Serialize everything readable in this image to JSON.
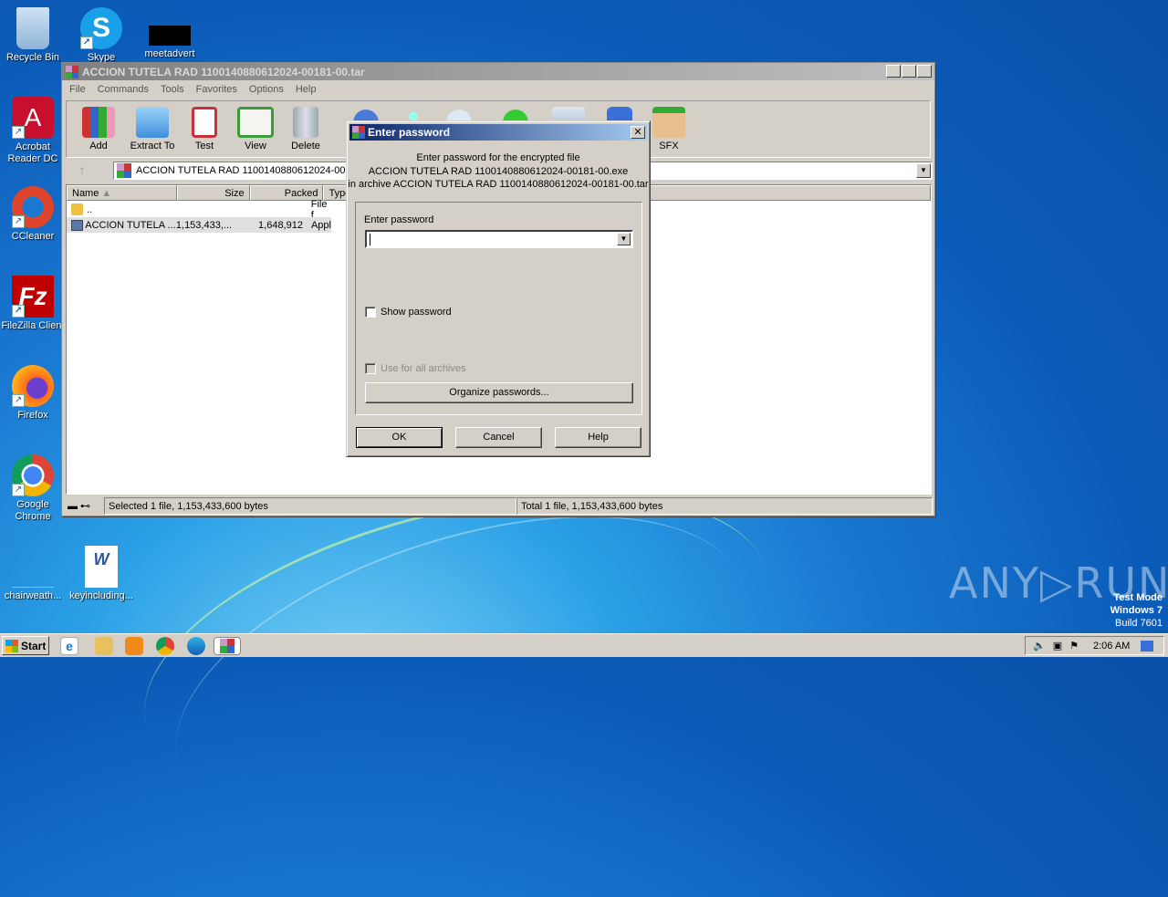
{
  "desktop": {
    "icons": [
      {
        "label": "Recycle Bin",
        "icon": "recycle-bin-icon"
      },
      {
        "label": "Skype",
        "icon": "skype-icon"
      },
      {
        "label": "meetadvert",
        "icon": "file-icon"
      },
      {
        "label": "Acrobat Reader DC",
        "icon": "acrobat-icon"
      },
      {
        "label": "CCleaner",
        "icon": "ccleaner-icon"
      },
      {
        "label": "FileZilla Client",
        "icon": "filezilla-icon"
      },
      {
        "label": "Firefox",
        "icon": "firefox-icon"
      },
      {
        "label": "Google Chrome",
        "icon": "chrome-icon"
      },
      {
        "label": "chairweath...",
        "icon": "blank-file-icon"
      },
      {
        "label": "keyincluding...",
        "icon": "word-doc-icon"
      }
    ],
    "watermark": {
      "brand": "ANY▷RUN",
      "line1": "Test Mode",
      "line2": "Windows 7",
      "line3": "Build 7601"
    }
  },
  "window": {
    "title": "ACCION TUTELA RAD 1100140880612024-00181-00.tar",
    "menu": [
      "File",
      "Commands",
      "Tools",
      "Favorites",
      "Options",
      "Help"
    ],
    "toolbar": [
      {
        "label": "Add",
        "icon": "add-icon"
      },
      {
        "label": "Extract To",
        "icon": "extract-icon"
      },
      {
        "label": "Test",
        "icon": "test-icon"
      },
      {
        "label": "View",
        "icon": "view-icon"
      },
      {
        "label": "Delete",
        "icon": "delete-icon"
      },
      {
        "label": "SFX",
        "icon": "sfx-icon"
      }
    ],
    "address": "ACCION TUTELA RAD 1100140880612024-00181-00.tar",
    "columns": [
      "Name",
      "Size",
      "Packed",
      "Type"
    ],
    "rows": [
      {
        "name": "..",
        "size": "",
        "packed": "",
        "type": "File f"
      },
      {
        "name": "ACCION TUTELA ...",
        "size": "1,153,433,...",
        "packed": "1,648,912",
        "type": "Appl"
      }
    ],
    "status_left": "Selected 1 file, 1,153,433,600 bytes",
    "status_right": "Total 1 file, 1,153,433,600 bytes"
  },
  "dialog": {
    "title": "Enter password",
    "msg1": "Enter password for the encrypted file",
    "msg2": "ACCION TUTELA RAD 1100140880612024-00181-00.exe",
    "msg3": "in archive ACCION TUTELA RAD 1100140880612024-00181-00.tar",
    "field_label": "Enter password",
    "password_value": "",
    "show_password": "Show password",
    "use_all": "Use for all archives",
    "organize": "Organize passwords...",
    "ok": "OK",
    "cancel": "Cancel",
    "help": "Help"
  },
  "taskbar": {
    "start": "Start",
    "clock": "2:06 AM"
  }
}
